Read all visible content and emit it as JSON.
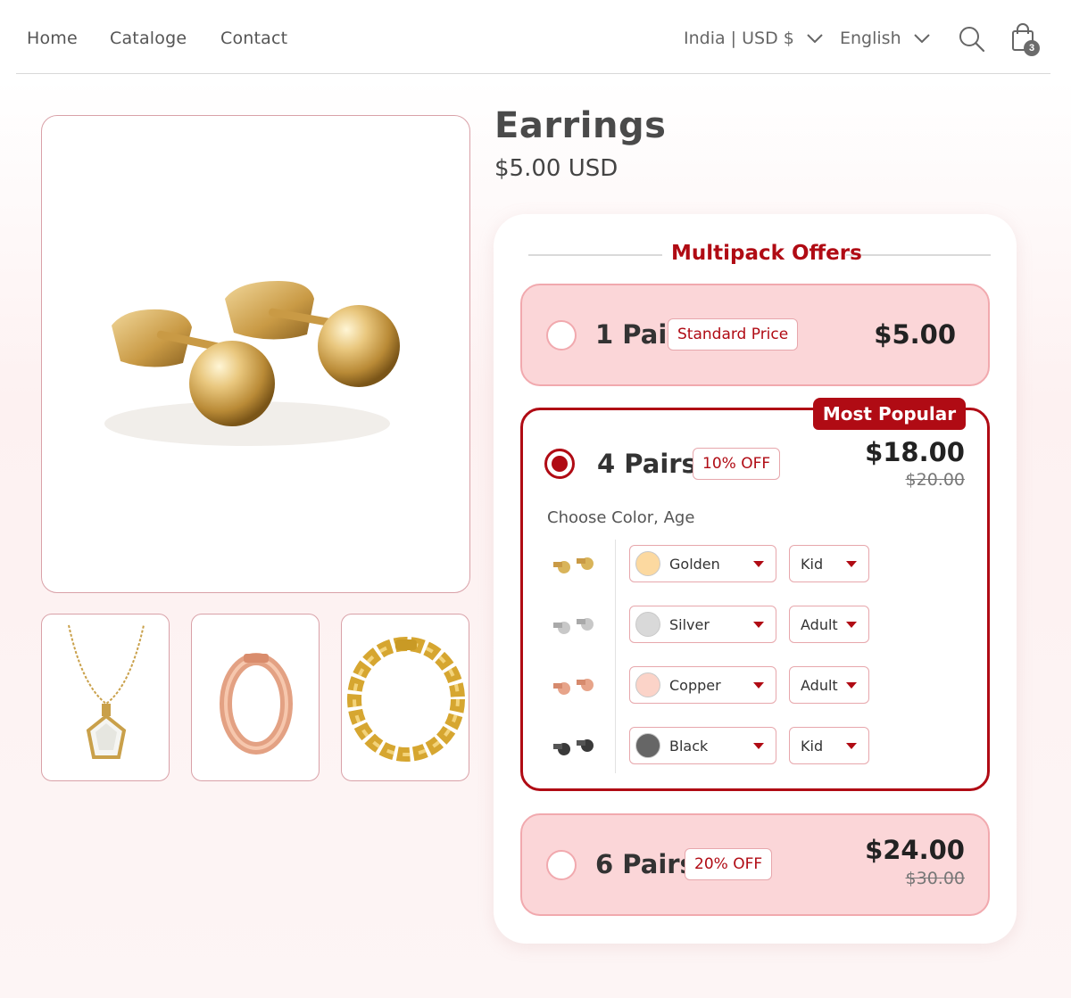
{
  "nav": {
    "links": [
      "Home",
      "Cataloge",
      "Contact"
    ],
    "region": "India | USD $",
    "language": "English",
    "cart_count": "3"
  },
  "product": {
    "title": "Earrings",
    "price": "$5.00 USD"
  },
  "multipack": {
    "heading": "Multipack Offers",
    "offers": [
      {
        "label": "1 Pair",
        "tag": "Standard Price",
        "price": "$5.00",
        "selected": false
      },
      {
        "label": "4 Pairs",
        "tag": "10% OFF",
        "price": "$18.00",
        "old_price": "$20.00",
        "badge": "Most Popular",
        "selected": true
      },
      {
        "label": "6 Pairs",
        "tag": "20% OFF",
        "price": "$24.00",
        "old_price": "$30.00",
        "selected": false
      }
    ],
    "choose_label": "Choose Color, Age",
    "variants": [
      {
        "color": "Golden",
        "swatch": "#fcd9a0",
        "age": "Kid"
      },
      {
        "color": "Silver",
        "swatch": "#d9d9d9",
        "age": "Adult"
      },
      {
        "color": "Copper",
        "swatch": "#fbd3c8",
        "age": "Adult"
      },
      {
        "color": "Black",
        "swatch": "#666666",
        "age": "Kid"
      }
    ]
  },
  "colors": {
    "accent": "#b00b14",
    "offer_bg": "#fbd6d8",
    "offer_border": "#f1a9ae"
  }
}
